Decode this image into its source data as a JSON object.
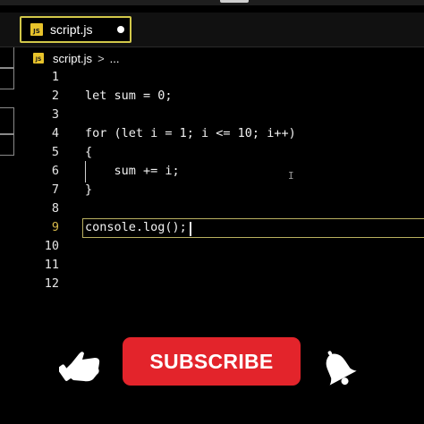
{
  "editor": {
    "tab": {
      "label": "script.js",
      "file_badge": "JS",
      "unsaved_dot": true
    },
    "breadcrumb": {
      "file_badge": "JS",
      "file": "script.js",
      "separator": ">",
      "more": "..."
    },
    "line_numbers": [
      "1",
      "2",
      "3",
      "4",
      "5",
      "6",
      "7",
      "8",
      "9",
      "10",
      "11",
      "12"
    ],
    "active_line": "9",
    "code_lines": [
      "",
      "let sum = 0;",
      "",
      "for (let i = 1; i <= 10; i++)",
      "{",
      "    sum += i;",
      "}",
      "",
      "console.log();",
      "",
      "",
      ""
    ]
  },
  "overlay": {
    "subscribe_label": "SUBSCRIBE",
    "like_icon": "hand-thumbs-up-icon",
    "bell_icon": "bell-icon"
  },
  "colors": {
    "background": "#000000",
    "tab_border": "#d2c84a",
    "js_badge": "#e8c32b",
    "active_line_number": "#d7b84a",
    "subscribe_button": "#e3242b"
  }
}
